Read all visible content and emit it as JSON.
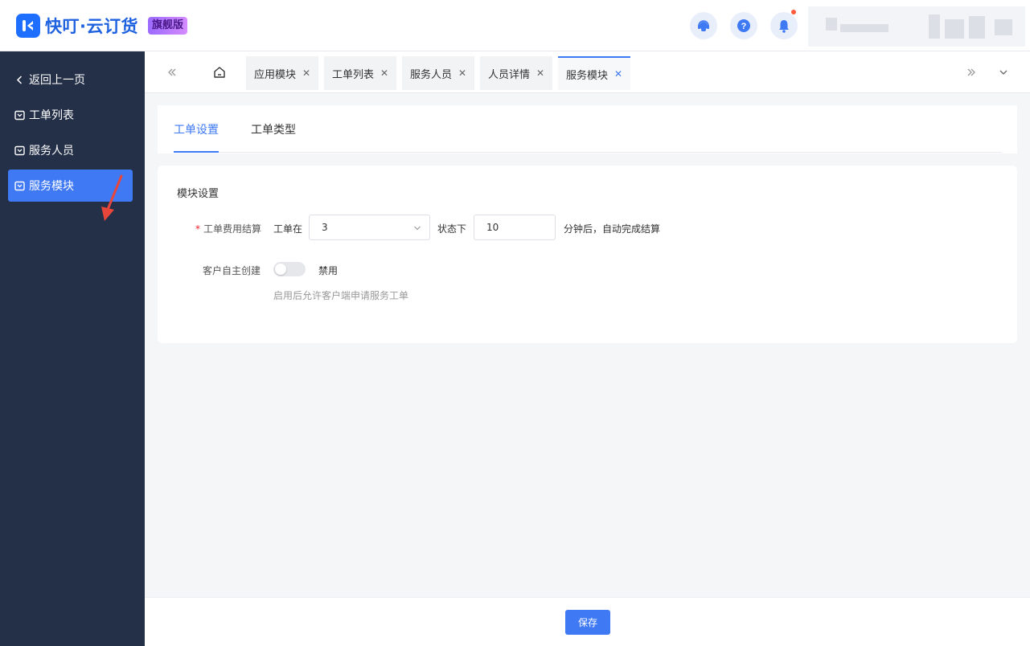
{
  "header": {
    "app_name": "快叮·云订货",
    "edition": "旗舰版",
    "colors": {
      "brand": "#1e6fff",
      "accent": "#3f79f4",
      "sidebar_bg": "#242f48",
      "notify": "#ff5a3c"
    }
  },
  "sidebar": {
    "back_label": "返回上一页",
    "items": [
      {
        "label": "工单列表"
      },
      {
        "label": "服务人员"
      },
      {
        "label": "服务模块"
      }
    ]
  },
  "tabs": [
    {
      "label": "应用模块"
    },
    {
      "label": "工单列表"
    },
    {
      "label": "服务人员"
    },
    {
      "label": "人员详情"
    },
    {
      "label": "服务模块"
    }
  ],
  "subtabs": [
    {
      "label": "工单设置"
    },
    {
      "label": "工单类型"
    }
  ],
  "module_settings": {
    "title": "模块设置",
    "fee_settlement": {
      "label": "工单费用结算",
      "prefix": "工单在",
      "status_value": "3",
      "middle": "状态下",
      "minutes_value": "10",
      "suffix": "分钟后，自动完成结算"
    },
    "self_create": {
      "label": "客户自主创建",
      "switch_state": "禁用",
      "hint": "启用后允许客户端申请服务工单"
    }
  },
  "footer": {
    "save_label": "保存"
  }
}
